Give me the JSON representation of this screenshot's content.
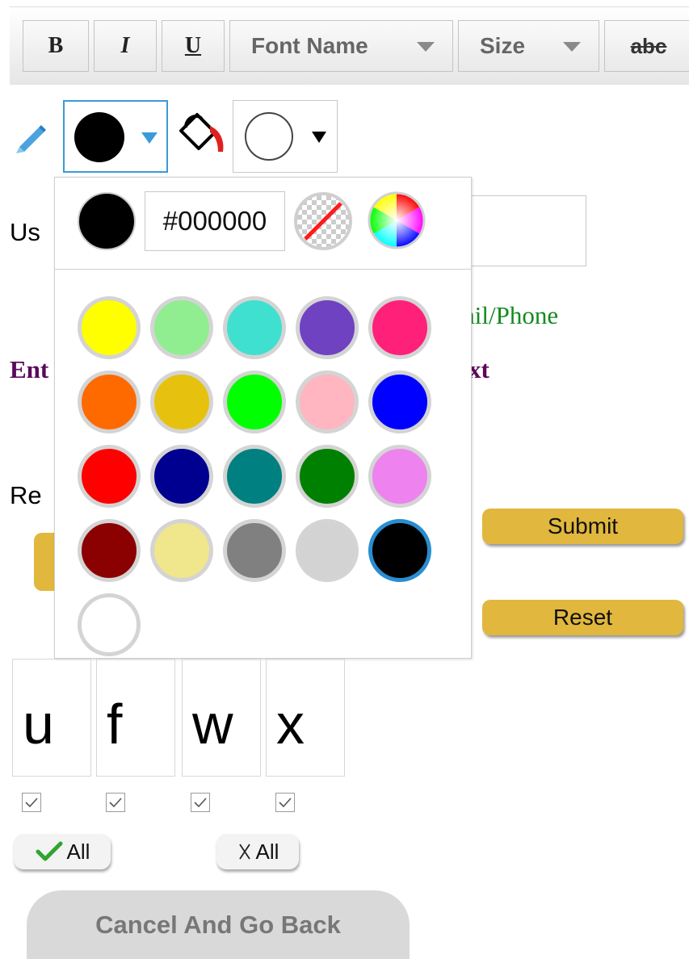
{
  "toolbar": {
    "bold_label": "B",
    "italic_label": "I",
    "underline_label": "U",
    "font_name_label": "Font Name",
    "size_label": "Size",
    "strike_label": "abc"
  },
  "color_row": {
    "pencil_icon": "pencil-icon",
    "text_color": "#000000",
    "bucket_icon": "paint-bucket-icon",
    "background_color": "#ffffff"
  },
  "palette": {
    "current_color": "#000000",
    "hex_value": "#000000",
    "no_color_icon": "no-color-icon",
    "color_wheel_icon": "color-wheel-icon",
    "swatches": [
      "#ffff00",
      "#90ee90",
      "#40e0d0",
      "#6f42c1",
      "#ff2079",
      "#ff6a00",
      "#e6c20e",
      "#00ff00",
      "#ffb6c1",
      "#0000ff",
      "#ff0000",
      "#000090",
      "#008080",
      "#008000",
      "#ee82ee",
      "#8b0000",
      "#f0e68c",
      "#808080",
      "#d3d3d3",
      "#000000",
      "#ffffff"
    ],
    "selected_swatch": "#000000"
  },
  "form": {
    "user_label_partial": "Us",
    "hint_green": "ail/Phone",
    "hint_purple_left": "Ent",
    "hint_purple_right": "xt",
    "res_label_partial": "Re",
    "submit_label": "Submit",
    "reset_label": "Reset"
  },
  "tiles": [
    {
      "char": "u",
      "checked": true
    },
    {
      "char": "f",
      "checked": true
    },
    {
      "char": "w",
      "checked": true
    },
    {
      "char": "x",
      "checked": true
    }
  ],
  "buttons": {
    "check_all_label": "All",
    "uncheck_all_label": "All",
    "cancel_label": "Cancel And Go Back"
  }
}
